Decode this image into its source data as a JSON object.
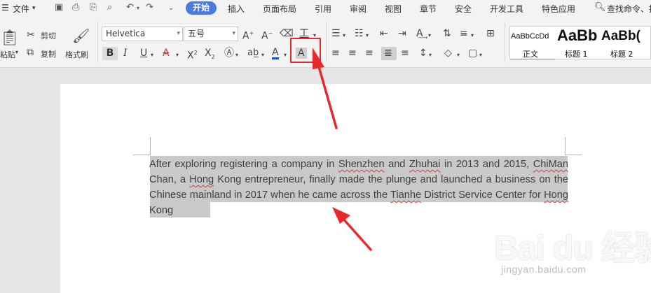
{
  "menubar": {
    "file": "文件",
    "tabs": [
      "开始",
      "插入",
      "页面布局",
      "引用",
      "审阅",
      "视图",
      "章节",
      "安全",
      "开发工具",
      "特色应用"
    ],
    "search": "查找命令、搜"
  },
  "ribbon": {
    "clipboard": {
      "paste": "粘贴",
      "cut": "剪切",
      "copy": "复制",
      "format_painter": "格式刷"
    },
    "font": {
      "name": "Helvetica",
      "size": "五号"
    },
    "styles": [
      {
        "preview": "AaBbCcDd",
        "name": "正文"
      },
      {
        "preview": "AaBb",
        "name": "标题 1"
      },
      {
        "preview": "AaBb(",
        "name": "标题 2"
      }
    ]
  },
  "document": {
    "segments": [
      {
        "t": "After exploring registering a company in ",
        "s": false
      },
      {
        "t": "Shenzhen",
        "s": true
      },
      {
        "t": " and ",
        "s": false
      },
      {
        "t": "Zhuhai",
        "s": true
      },
      {
        "t": " in 2013 and 2015, ",
        "s": false
      },
      {
        "t": "ChiMan",
        "s": true
      },
      {
        "t": " Chan, a ",
        "s": false
      },
      {
        "t": "Hong",
        "s": true
      },
      {
        "t": " Kong entrepreneur, finally made the plunge and launched a business on the Chinese mainland in 2017 when he came across the ",
        "s": false
      },
      {
        "t": "Tianhe",
        "s": true
      },
      {
        "t": " District Service Center for ",
        "s": false
      },
      {
        "t": "Hong",
        "s": true
      },
      {
        "t": " Kong",
        "s": false
      }
    ]
  },
  "watermark": {
    "logo": "Bai du 经验",
    "sub": "jingyan.baidu.com"
  },
  "colors": {
    "active_tab": "#4b7bd9",
    "highlight_box": "#e8292b",
    "arrow": "#e8292b",
    "selection": "#c9c9c9"
  }
}
